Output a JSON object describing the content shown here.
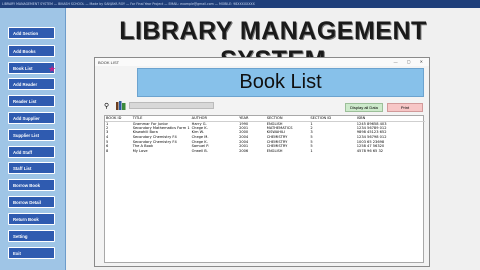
{
  "topbar": {
    "text": "LIBRARY MANAGEMENT SYSTEM — BIKASH SCHOOL — Made by SANJAYA ROY — For Final Year Project — EMAIL: example@gmail.com — MOBILE: 98XXXXXXXX"
  },
  "sidebar": {
    "items": [
      {
        "label": "Add Section"
      },
      {
        "label": "Add Books"
      },
      {
        "label": "Book List"
      },
      {
        "label": "Add Reader"
      },
      {
        "label": "Reader List"
      },
      {
        "label": "Add Supplier"
      },
      {
        "label": "Supplier List"
      },
      {
        "label": "Add Staff"
      },
      {
        "label": "Staff List"
      },
      {
        "label": "Borrow Book"
      },
      {
        "label": "Borrow Detail"
      },
      {
        "label": "Return Book"
      },
      {
        "label": "Setting"
      },
      {
        "label": "Exit"
      }
    ]
  },
  "headline": "LIBRARY MANAGEMENT SYSTEM",
  "window": {
    "title": "BOOK LIST",
    "controls": "— ▢ ✕",
    "banner": "Book List",
    "search": {
      "placeholder": ""
    },
    "display_button": "Display all Data",
    "print_button": "Print",
    "table": {
      "columns": [
        "BOOK ID",
        "TITLE",
        "AUTHOR",
        "YEAR",
        "SECTION",
        "SECTION ID",
        "ISBN"
      ],
      "rows": [
        [
          "1",
          "Grammar For Junior",
          "Harry G.",
          "1990",
          "ENGLISH",
          "1",
          "1245 89658 403"
        ],
        [
          "2",
          "Secondary Mathematics Form 1",
          "Chege K.",
          "2001",
          "MATHEMATICS",
          "2",
          "1234 56789 012"
        ],
        [
          "3",
          "Kiswahili Bora",
          "Kim W.",
          "2000",
          "KISWAHILI",
          "3",
          "9898 45123 652"
        ],
        [
          "4",
          "Secondary Chemistry F4",
          "Chege M.",
          "2004",
          "CHEMISTRY",
          "5",
          "1234 56798 012"
        ],
        [
          "5",
          "Secondary Chemistry F4",
          "Chege K.",
          "2004",
          "CHEMISTRY",
          "5",
          "1003 65 23698"
        ],
        [
          "6",
          "The A Book",
          "Samuel P.",
          "2001",
          "CHEMISTRY",
          "5",
          "1258 47 56320"
        ],
        [
          "8",
          "My Love",
          "Orwell B.",
          "2006",
          "ENGLISH",
          "1",
          "4578 96 65 32"
        ]
      ]
    }
  },
  "icons": {
    "search": "magnifier-icon",
    "books": "books-icon",
    "active_marker": "star-icon"
  },
  "colors": {
    "sidebar_bg": "#9fc5e6",
    "side_btn": "#2f5bb0",
    "banner": "#87c1ea",
    "star": "#c51f8a"
  }
}
